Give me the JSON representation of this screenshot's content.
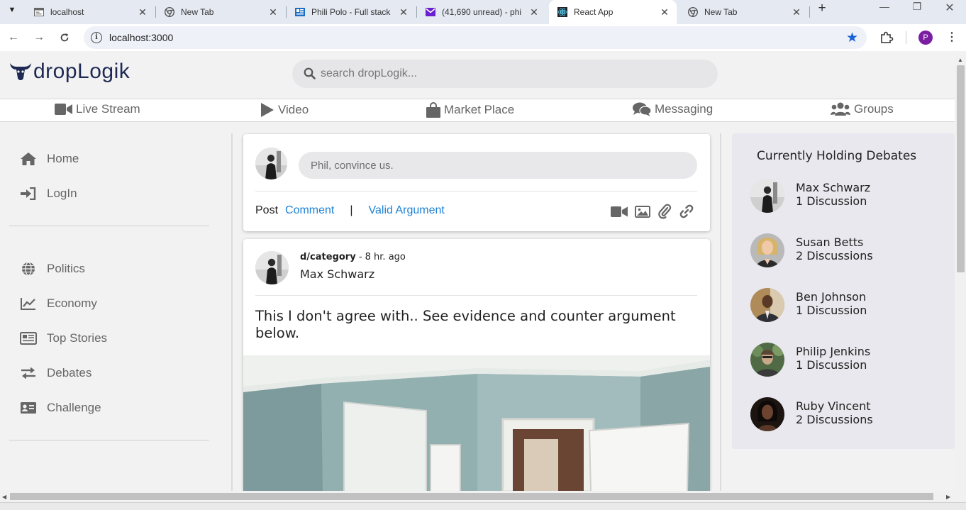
{
  "browser": {
    "tabs": [
      {
        "title": "localhost",
        "favicon": "page-icon"
      },
      {
        "title": "New Tab",
        "favicon": "chrome-icon"
      },
      {
        "title": "Phili Polo - Full stack",
        "favicon": "site-icon"
      },
      {
        "title": "(41,690 unread) - phi",
        "favicon": "mail-icon"
      },
      {
        "title": "React App",
        "favicon": "react-icon"
      },
      {
        "title": "New Tab",
        "favicon": "chrome-icon"
      }
    ],
    "active_tab": 4,
    "url": "localhost:3000",
    "profile_initial": "P",
    "accent": "#1a63d6"
  },
  "header": {
    "logo_text": "dropLogik",
    "logo_color": "#1f2a54",
    "search_placeholder": "search dropLogik..."
  },
  "topnav": [
    {
      "label": "Live Stream",
      "icon": "video-camera-icon"
    },
    {
      "label": "Video",
      "icon": "play-icon"
    },
    {
      "label": "Market Place",
      "icon": "shopping-bag-icon"
    },
    {
      "label": "Messaging",
      "icon": "comments-icon"
    },
    {
      "label": "Groups",
      "icon": "users-icon"
    }
  ],
  "sidebar": {
    "primary": [
      {
        "label": "Home",
        "icon": "home-icon"
      },
      {
        "label": "LogIn",
        "icon": "sign-in-icon"
      }
    ],
    "categories": [
      {
        "label": "Politics",
        "icon": "globe-icon"
      },
      {
        "label": "Economy",
        "icon": "line-chart-icon"
      },
      {
        "label": "Top Stories",
        "icon": "newspaper-icon"
      },
      {
        "label": "Debates",
        "icon": "exchange-icon"
      },
      {
        "label": "Challenge",
        "icon": "id-card-icon"
      }
    ]
  },
  "composer": {
    "placeholder": "Phil, convince us.",
    "post_label": "Post",
    "comment_label": "Comment",
    "separator": "|",
    "valid_argument_label": "Valid Argument",
    "link_color": "#1e82d6"
  },
  "post": {
    "category": "d/category",
    "time": " - 8 hr. ago",
    "author": "Max Schwarz",
    "text": "This I don't agree with.. See evidence and counter argument below."
  },
  "debates": {
    "title": "Currently Holding Debates",
    "people": [
      {
        "name": "Max Schwarz",
        "count": "1 Discussion"
      },
      {
        "name": "Susan Betts",
        "count": "2 Discussions"
      },
      {
        "name": "Ben Johnson",
        "count": "1 Discussion"
      },
      {
        "name": "Philip Jenkins",
        "count": "1 Discussion"
      },
      {
        "name": "Ruby Vincent",
        "count": "2 Discussions"
      }
    ]
  }
}
